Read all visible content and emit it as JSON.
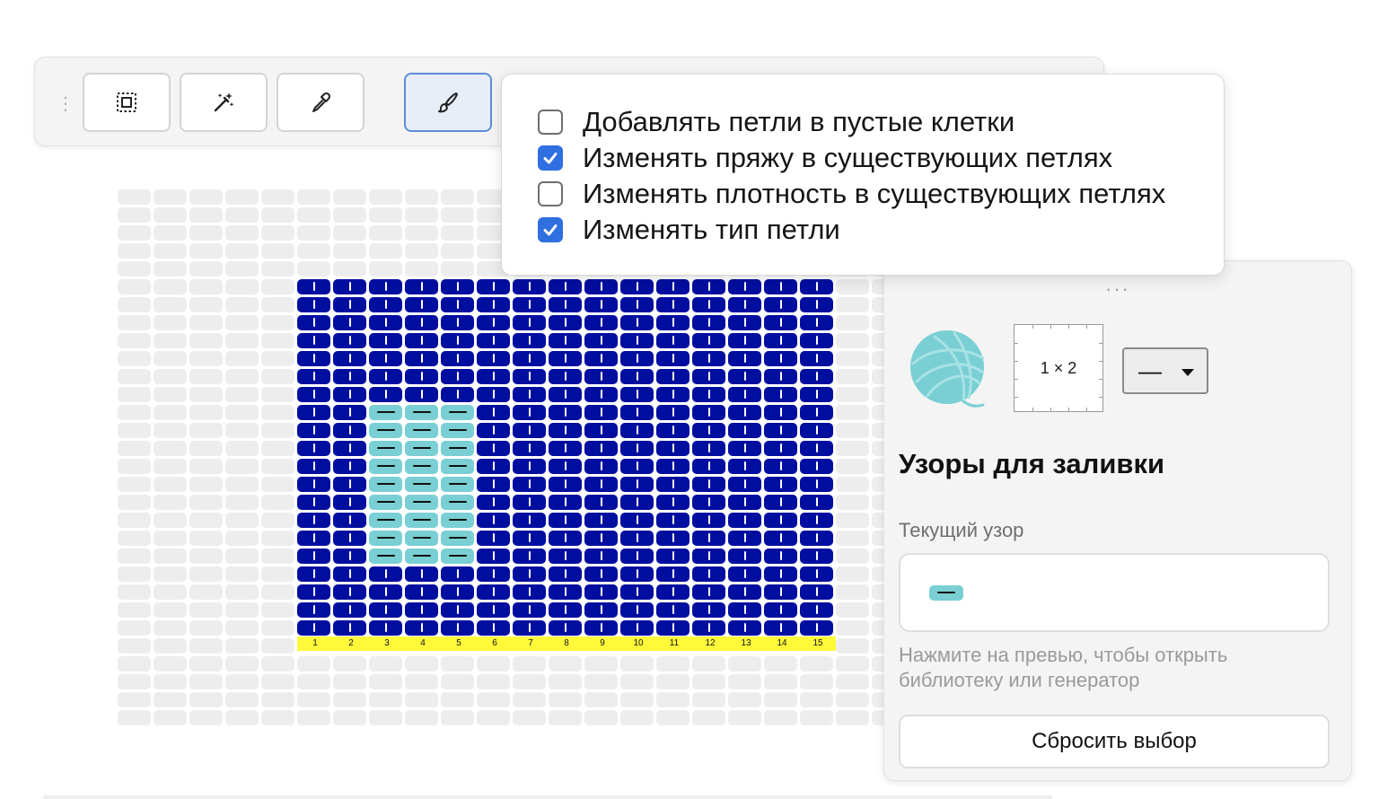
{
  "toolbar": {
    "tools": [
      {
        "icon": "selection-icon",
        "active": false
      },
      {
        "icon": "magic-wand-icon",
        "active": false
      },
      {
        "icon": "eyedropper-icon",
        "active": false
      },
      {
        "icon": "brush-icon",
        "active": true
      }
    ]
  },
  "fill_options": {
    "items": [
      {
        "label": "Добавлять петли в пустые клетки",
        "checked": false
      },
      {
        "label": "Изменять пряжу в существующих петлях",
        "checked": true
      },
      {
        "label": "Изменять плотность в существующих петлях",
        "checked": false
      },
      {
        "label": "Изменять тип петли",
        "checked": true
      }
    ]
  },
  "chart": {
    "columns": [
      "1",
      "2",
      "3",
      "4",
      "5",
      "6",
      "7",
      "8",
      "9",
      "10",
      "11",
      "12",
      "13",
      "14",
      "15"
    ],
    "row_count": 20,
    "colors": {
      "main_yarn": "#000ea0",
      "contrast_yarn": "#79cfd3",
      "empty": "#ededed",
      "numbers_bg": "#fff93a"
    },
    "purl_block": {
      "from_column": 3,
      "to_column": 5,
      "rows_from_top": [
        7,
        15
      ]
    }
  },
  "panel": {
    "yarn_color": "#79cfd3",
    "gauge_label": "1 × 2",
    "line_style_value": "—",
    "title": "Узоры для заливки",
    "current_pattern_label": "Текущий узор",
    "hint": "Нажмите на превью, чтобы открыть библиотеку или генератор",
    "reset_label": "Сбросить выбор"
  }
}
